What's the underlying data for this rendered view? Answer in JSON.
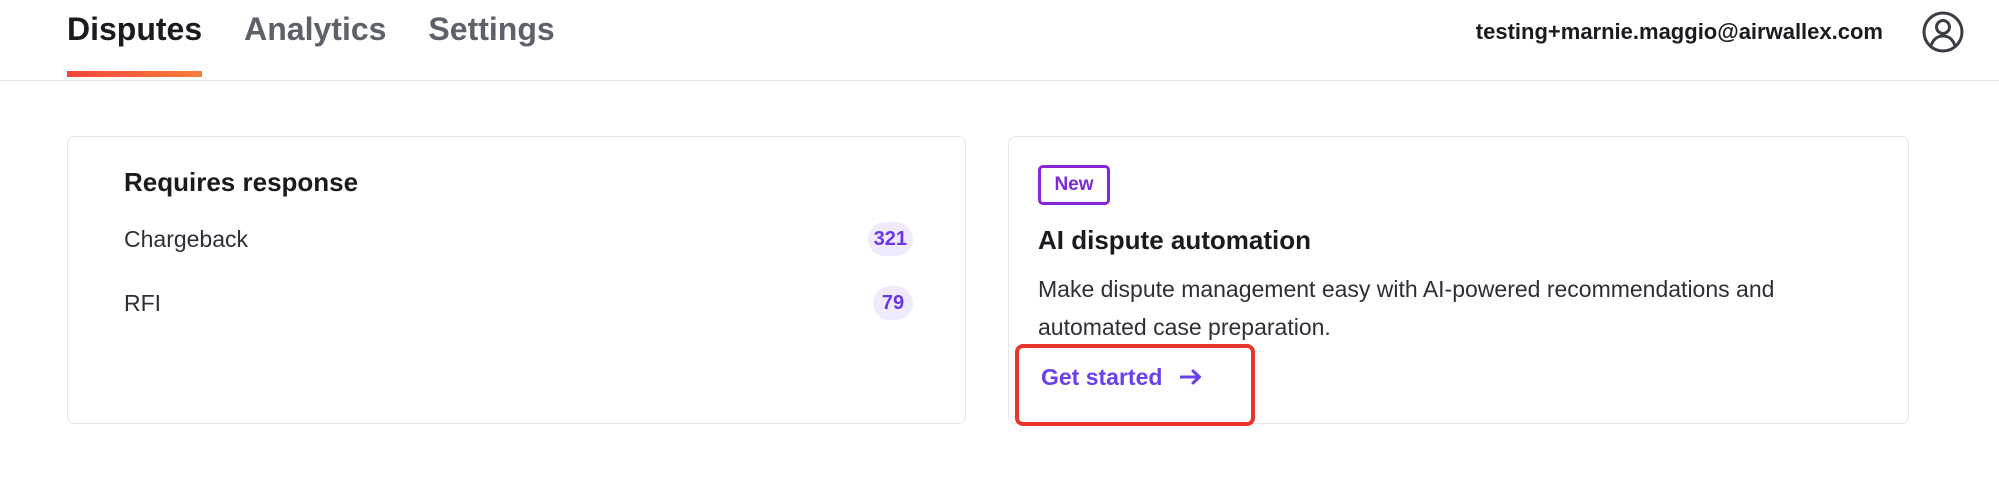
{
  "nav": {
    "tabs": [
      {
        "label": "Disputes",
        "active": true
      },
      {
        "label": "Analytics",
        "active": false
      },
      {
        "label": "Settings",
        "active": false
      }
    ],
    "user_email": "testing+marnie.maggio@airwallex.com",
    "avatar_icon": "user-circle-icon"
  },
  "requires_response": {
    "title": "Requires response",
    "rows": [
      {
        "label": "Chargeback",
        "count": "321"
      },
      {
        "label": "RFI",
        "count": "79"
      }
    ]
  },
  "ai_card": {
    "badge": "New",
    "title": "AI dispute automation",
    "description": "Make dispute management easy with AI-powered recommendations and automated case preparation.",
    "cta_label": "Get started",
    "cta_icon": "arrow-right-icon"
  },
  "colors": {
    "tab_underline": "#f4433b",
    "accent_purple": "#6a3ff0",
    "badge_border": "#8a26d6",
    "count_badge_bg": "#efeafd",
    "highlight_red": "#e8342a"
  }
}
